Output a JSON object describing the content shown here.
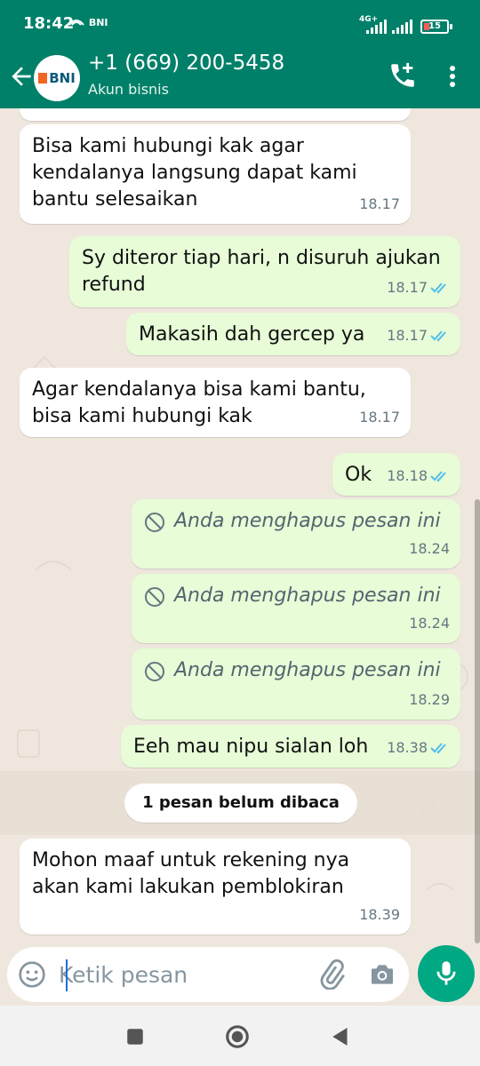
{
  "status_bar": {
    "time": "18:42",
    "notification_text": "BNI",
    "network": "4G+",
    "battery": "15"
  },
  "header": {
    "avatar_text": "BNI",
    "contact_name": "+1 (669) 200-5458",
    "subtitle": "Akun bisnis"
  },
  "messages": [
    {
      "direction": "in",
      "text": "Bisa kami hubungi kak agar kendalanya langsung dapat kami bantu selesaikan",
      "time": "18.17"
    },
    {
      "direction": "out",
      "text": "Sy diteror tiap hari, n disuruh ajukan refund",
      "time": "18.17",
      "read": true
    },
    {
      "direction": "out",
      "text": "Makasih dah gercep ya",
      "time": "18.17",
      "read": true
    },
    {
      "direction": "in",
      "text": "Agar kendalanya bisa kami bantu, bisa kami hubungi kak",
      "time": "18.17"
    },
    {
      "direction": "out",
      "text": "Ok",
      "time": "18.18",
      "read": true
    },
    {
      "direction": "out",
      "text": "Anda menghapus pesan ini",
      "time": "18.24",
      "deleted": true
    },
    {
      "direction": "out",
      "text": "Anda menghapus pesan ini",
      "time": "18.24",
      "deleted": true
    },
    {
      "direction": "out",
      "text": "Anda menghapus pesan ini",
      "time": "18.29",
      "deleted": true
    },
    {
      "direction": "out",
      "text": "Eeh mau nipu sialan loh",
      "time": "18.38",
      "read": true
    },
    {
      "direction": "in",
      "text": "Mohon maaf untuk rekening nya akan kami lakukan pemblokiran",
      "time": "18.39"
    }
  ],
  "unread_divider": "1 pesan belum dibaca",
  "composer": {
    "placeholder": "Ketik pesan"
  },
  "colors": {
    "header": "#008069",
    "outgoing_bubble": "#e7fcd7",
    "incoming_bubble": "#ffffff",
    "chat_background": "#efe7de",
    "read_ticks": "#53bdeb",
    "mic_button": "#00a884"
  },
  "icons": [
    "back-arrow-icon",
    "add-call-icon",
    "more-vertical-icon",
    "blocked-icon",
    "double-check-icon",
    "emoji-icon",
    "attach-icon",
    "camera-icon",
    "mic-icon",
    "recent-apps-icon",
    "home-icon",
    "back-nav-icon"
  ]
}
